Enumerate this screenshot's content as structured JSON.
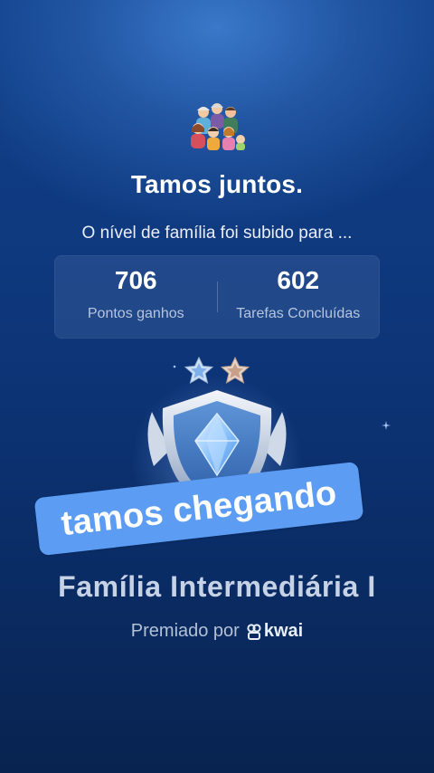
{
  "header": {
    "title": "Tamos juntos.",
    "subtitle": "O nível de família foi subido para ..."
  },
  "stats": [
    {
      "value": "706",
      "label": "Pontos ganhos"
    },
    {
      "value": "602",
      "label": "Tarefas Concluídas"
    }
  ],
  "badge": {
    "stars_total": 2,
    "stars_filled": 2
  },
  "overlay": {
    "sticker_text": "tamos chegando"
  },
  "level": {
    "name": "Família Intermediária I"
  },
  "award": {
    "prefix": "Premiado por",
    "brand": "kwai"
  },
  "icons": {
    "family": "family-group-icon",
    "badge": "shield-badge-icon",
    "star": "star-icon",
    "brand": "kwai-logo-icon"
  },
  "colors": {
    "background_top": "#0e3d86",
    "background_bottom": "#08234f",
    "sticker": "#5c9cf3",
    "level_text": "#c6d2e6"
  }
}
